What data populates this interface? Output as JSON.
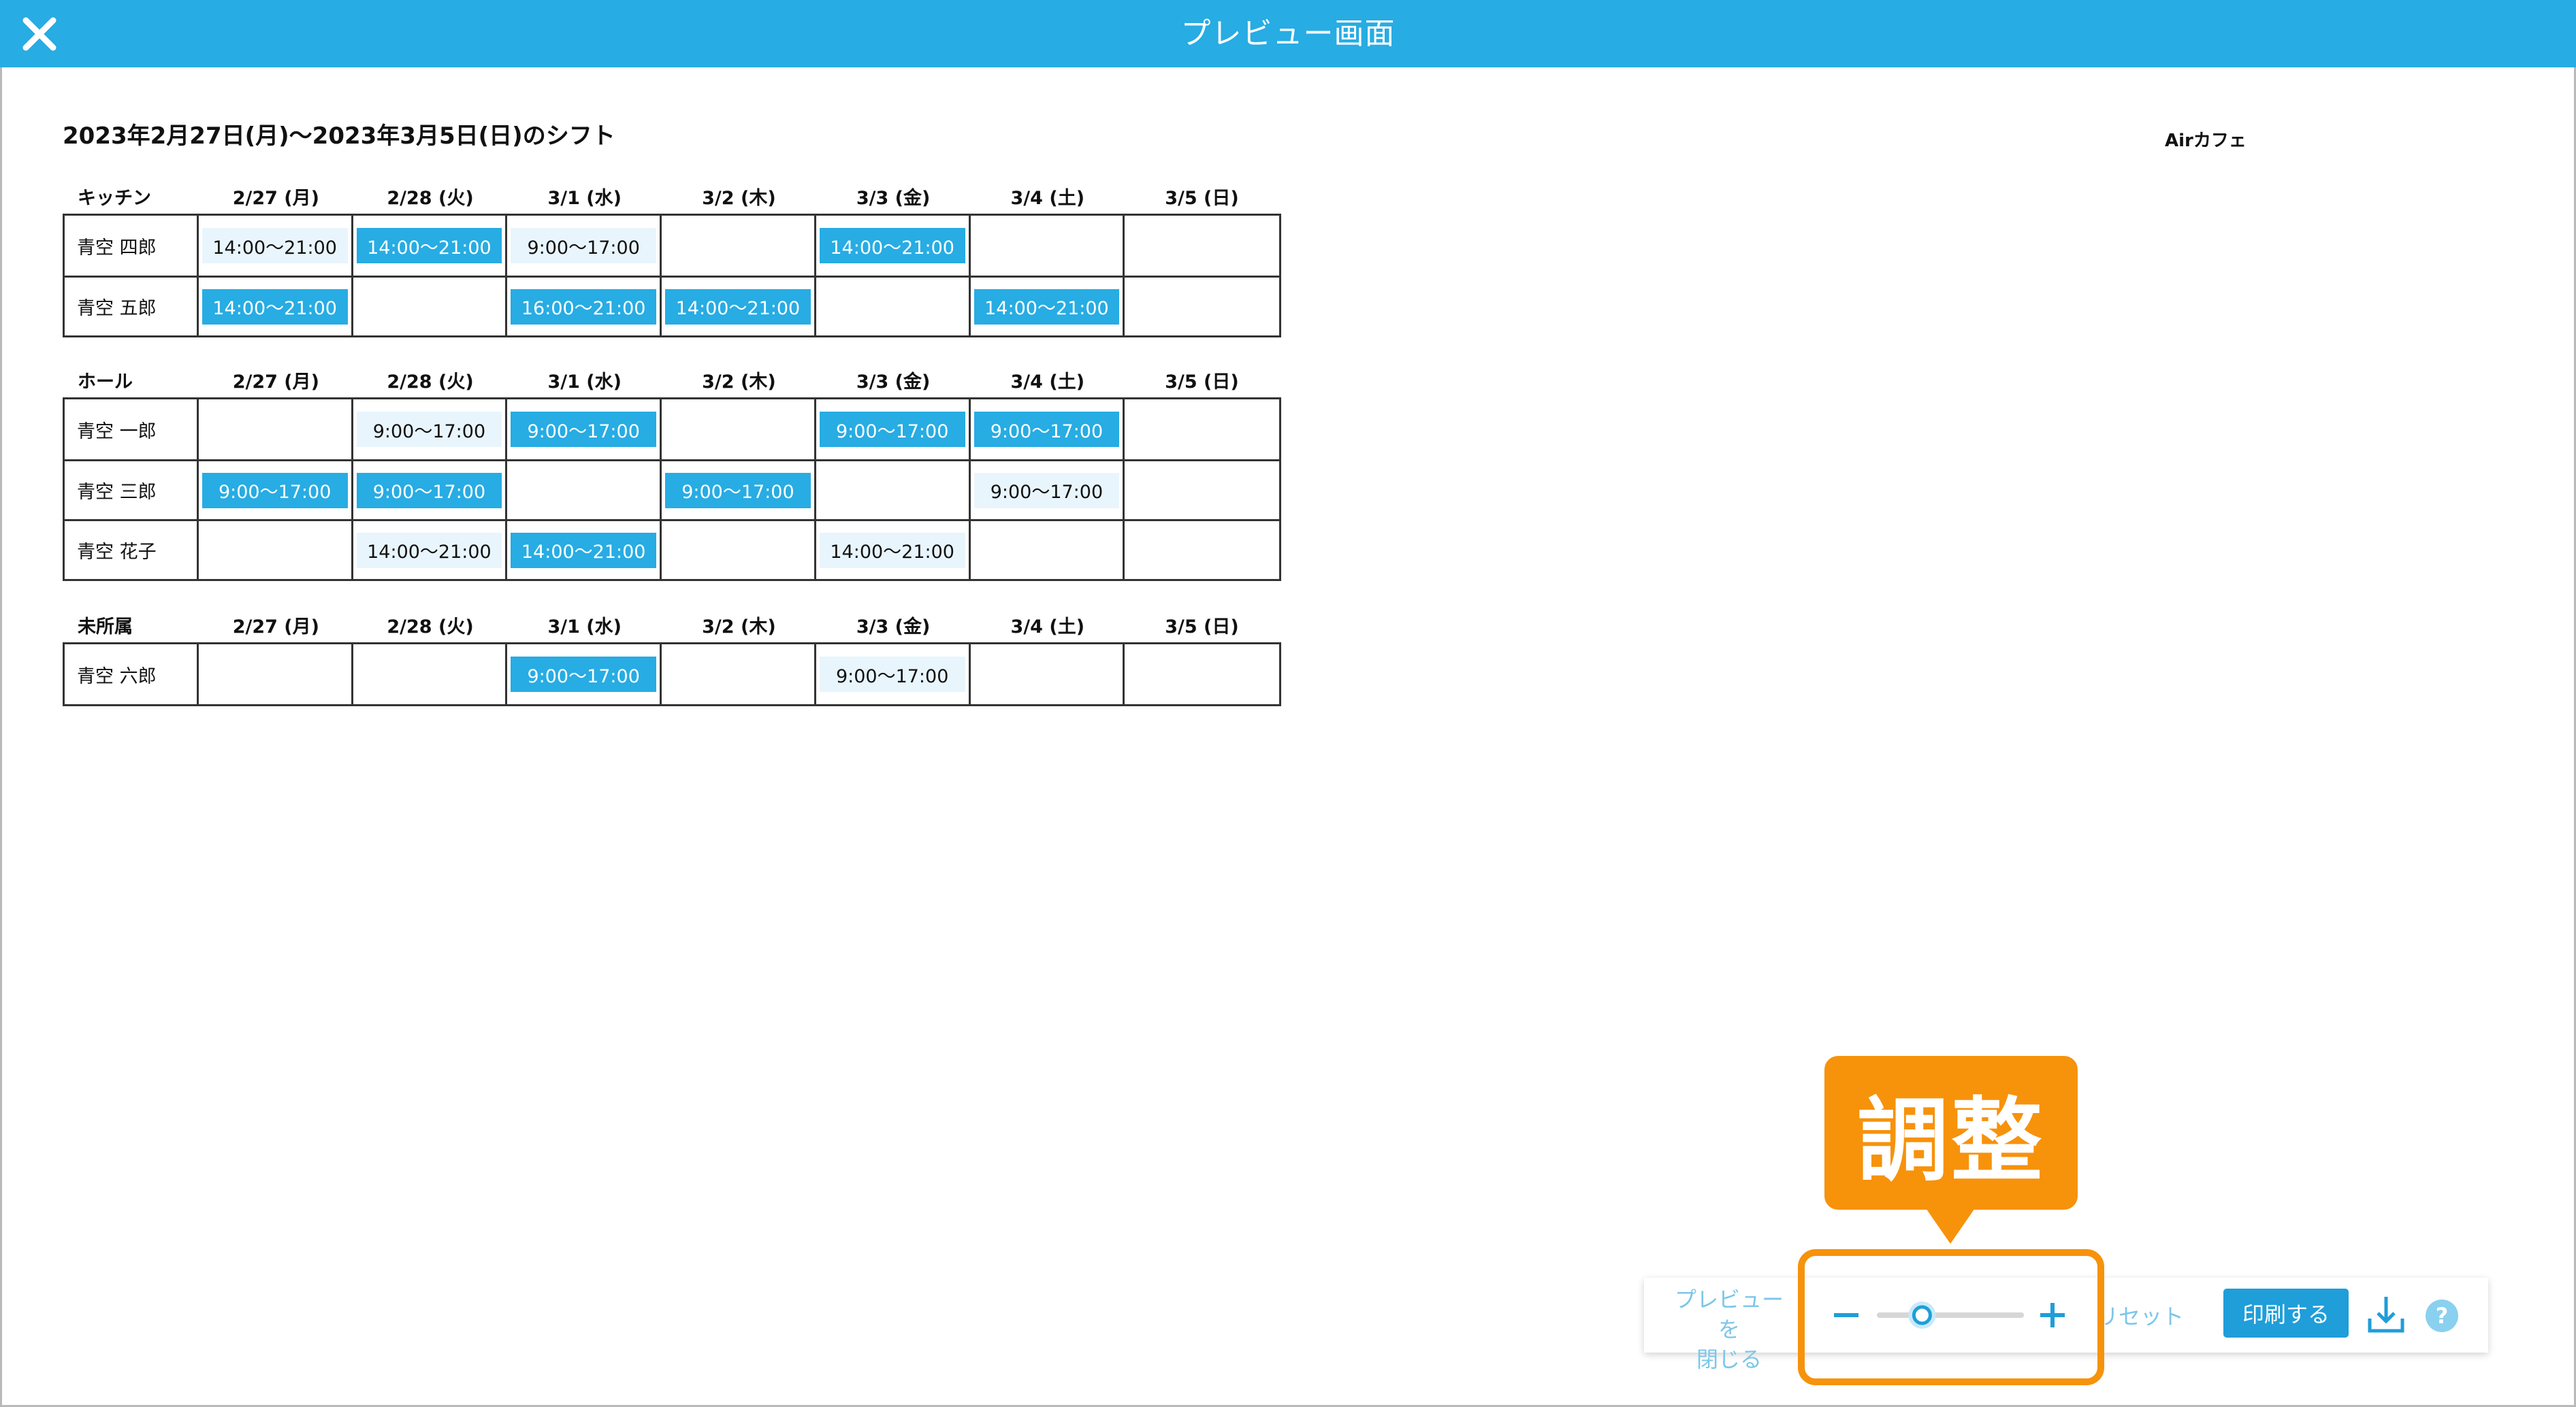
{
  "header": {
    "title": "プレビュー画面",
    "accent_color": "#27ace3",
    "close_icon": "close-icon"
  },
  "document": {
    "period_title": "2023年2月27日(月)〜2023年3月5日(日)のシフト",
    "store_name": "Airカフェ",
    "days": [
      "2/27 (月)",
      "2/28 (火)",
      "3/1 (水)",
      "3/2 (木)",
      "3/3 (金)",
      "3/4 (土)",
      "3/5 (日)"
    ],
    "sections": [
      {
        "name": "キッチン",
        "rows": [
          {
            "person": "青空 四郎",
            "shifts": [
              {
                "text": "14:00〜21:00",
                "style": "light"
              },
              {
                "text": "14:00〜21:00",
                "style": "dark"
              },
              {
                "text": "9:00〜17:00",
                "style": "light"
              },
              null,
              {
                "text": "14:00〜21:00",
                "style": "dark"
              },
              null,
              null
            ]
          },
          {
            "person": "青空 五郎",
            "shifts": [
              {
                "text": "14:00〜21:00",
                "style": "dark"
              },
              null,
              {
                "text": "16:00〜21:00",
                "style": "dark"
              },
              {
                "text": "14:00〜21:00",
                "style": "dark"
              },
              null,
              {
                "text": "14:00〜21:00",
                "style": "dark"
              },
              null
            ]
          }
        ]
      },
      {
        "name": "ホール",
        "rows": [
          {
            "person": "青空 一郎",
            "shifts": [
              null,
              {
                "text": "9:00〜17:00",
                "style": "light"
              },
              {
                "text": "9:00〜17:00",
                "style": "dark"
              },
              null,
              {
                "text": "9:00〜17:00",
                "style": "dark"
              },
              {
                "text": "9:00〜17:00",
                "style": "dark"
              },
              null
            ]
          },
          {
            "person": "青空 三郎",
            "shifts": [
              {
                "text": "9:00〜17:00",
                "style": "dark"
              },
              {
                "text": "9:00〜17:00",
                "style": "dark"
              },
              null,
              {
                "text": "9:00〜17:00",
                "style": "dark"
              },
              null,
              {
                "text": "9:00〜17:00",
                "style": "light"
              },
              null
            ]
          },
          {
            "person": "青空 花子",
            "shifts": [
              null,
              {
                "text": "14:00〜21:00",
                "style": "light"
              },
              {
                "text": "14:00〜21:00",
                "style": "dark"
              },
              null,
              {
                "text": "14:00〜21:00",
                "style": "light"
              },
              null,
              null
            ]
          }
        ]
      },
      {
        "name": "未所属",
        "rows": [
          {
            "person": "青空 六郎",
            "shifts": [
              null,
              null,
              {
                "text": "9:00〜17:00",
                "style": "dark"
              },
              null,
              {
                "text": "9:00〜17:00",
                "style": "light"
              },
              null,
              null
            ]
          }
        ]
      }
    ]
  },
  "toolbar": {
    "close_preview_line1": "プレビューを",
    "close_preview_line2": "閉じる",
    "reset_label": "リセット",
    "print_label": "印刷する",
    "help_label": "?",
    "zoom_level": 0.3,
    "icons": [
      "minus-icon",
      "slider-thumb",
      "plus-icon",
      "download-icon",
      "help-icon"
    ]
  },
  "callout": {
    "text": "調整",
    "color": "#f7920b"
  }
}
